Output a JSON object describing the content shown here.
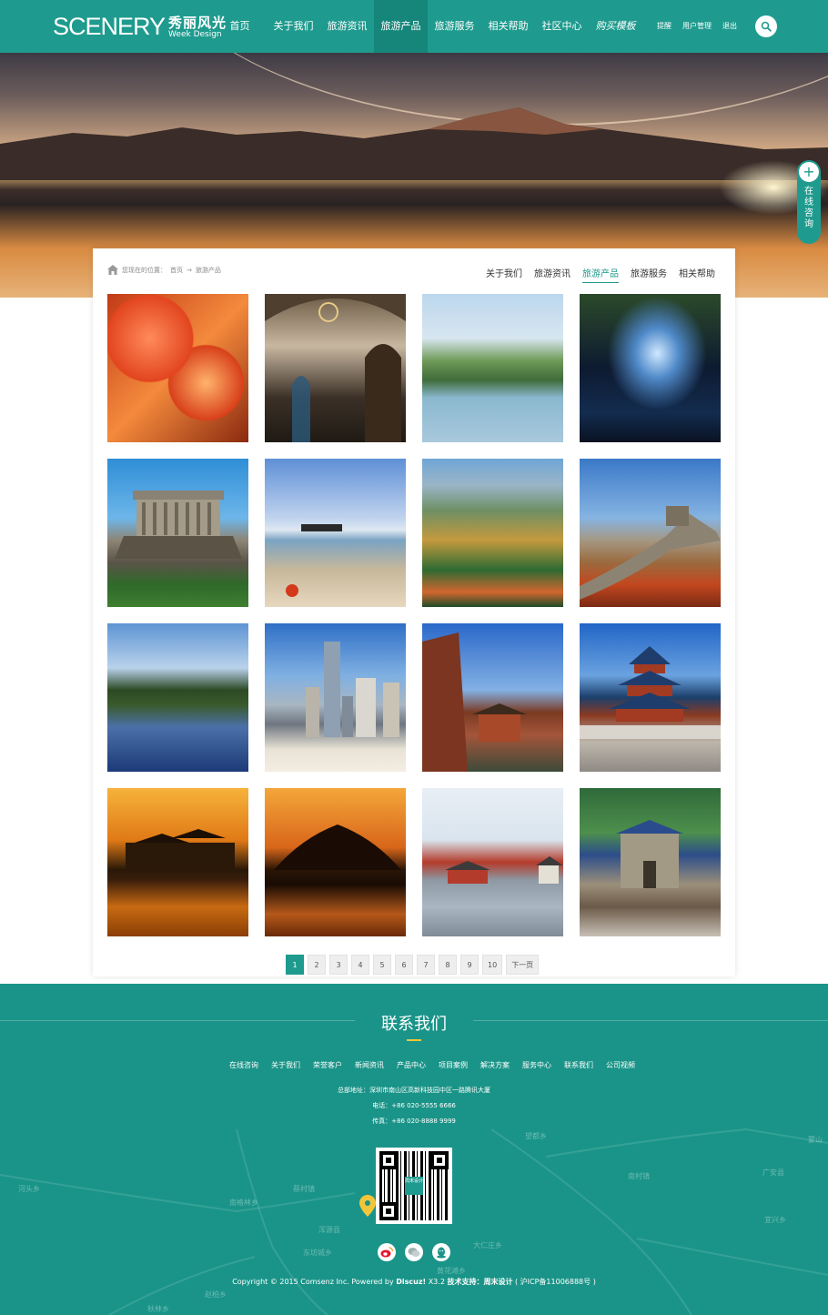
{
  "header": {
    "logo_main": "SCENERY",
    "logo_cn": "秀丽风光",
    "logo_en": "Week Design",
    "nav": [
      {
        "label": "首页",
        "active": false
      },
      {
        "label": "关于我们",
        "active": false
      },
      {
        "label": "旅游资讯",
        "active": false
      },
      {
        "label": "旅游产品",
        "active": true
      },
      {
        "label": "旅游服务",
        "active": false
      },
      {
        "label": "相关帮助",
        "active": false
      },
      {
        "label": "社区中心",
        "active": false
      },
      {
        "label": "购买模板",
        "active": false
      }
    ],
    "top_links": [
      "提醒",
      "用户管理",
      "退出"
    ],
    "search_icon": "search-icon"
  },
  "consult": {
    "icon": "+",
    "label": "在线咨询"
  },
  "breadcrumb": {
    "prefix": "您现在的位置：",
    "home": "首页",
    "arrow": "→",
    "current": "旅游产品"
  },
  "sub_nav": [
    {
      "label": "关于我们",
      "active": false
    },
    {
      "label": "旅游资讯",
      "active": false
    },
    {
      "label": "旅游产品",
      "active": true
    },
    {
      "label": "旅游服务",
      "active": false
    },
    {
      "label": "相关帮助",
      "active": false
    }
  ],
  "gallery": [
    "red-leaves-photo",
    "church-interior-photo",
    "lake-resort-photo",
    "cave-stream-photo",
    "mausoleum-photo",
    "beach-boat-photo",
    "autumn-hills-photo",
    "great-wall-photo",
    "forest-lake-photo",
    "city-skyline-photo",
    "temple-roof-photo",
    "temple-of-heaven-photo",
    "sunset-pavilion-photo",
    "sunset-island-photo",
    "lakeside-pavilion-photo",
    "memorial-gate-photo"
  ],
  "pagination": {
    "pages": [
      "1",
      "2",
      "3",
      "4",
      "5",
      "6",
      "7",
      "8",
      "9",
      "10"
    ],
    "current": "1",
    "next": "下一页"
  },
  "footer": {
    "title": "联系我们",
    "links": [
      "在线咨询",
      "关于我们",
      "荣誉客户",
      "新闻资讯",
      "产品中心",
      "项目案例",
      "解决方案",
      "服务中心",
      "联系我们",
      "公司视频"
    ],
    "address": "总部地址：深圳市南山区高新科技园中区一路腾讯大厦",
    "phone": "电话：+86 020-5555 6666",
    "fax": "传真：+86 020-8888 9999",
    "qr_logo": "周末设计",
    "social": [
      "weibo-icon",
      "wechat-icon",
      "qq-icon"
    ],
    "copyright_pre": "Copyright © 2015 Comsenz Inc. Powered by ",
    "copyright_brand": "Discuz!",
    "copyright_ver": " X3.2 ",
    "copyright_support": "技术支持：周末设计",
    "copyright_icp": " ( 沪ICP备11006888号 )",
    "map_labels": [
      "河头乡",
      "南格林乡",
      "蔡村镇",
      "东坊城乡",
      "望都乡",
      "南村镇",
      "广安县",
      "宜兴乡",
      "蒙山",
      "大仁庄乡",
      "黄花滩乡",
      "秋林乡",
      "赵柏乡",
      "浑源县"
    ]
  },
  "colors": {
    "primary": "#1e9b8e",
    "primary_dark": "#16867a",
    "accent": "#f3c63a"
  }
}
